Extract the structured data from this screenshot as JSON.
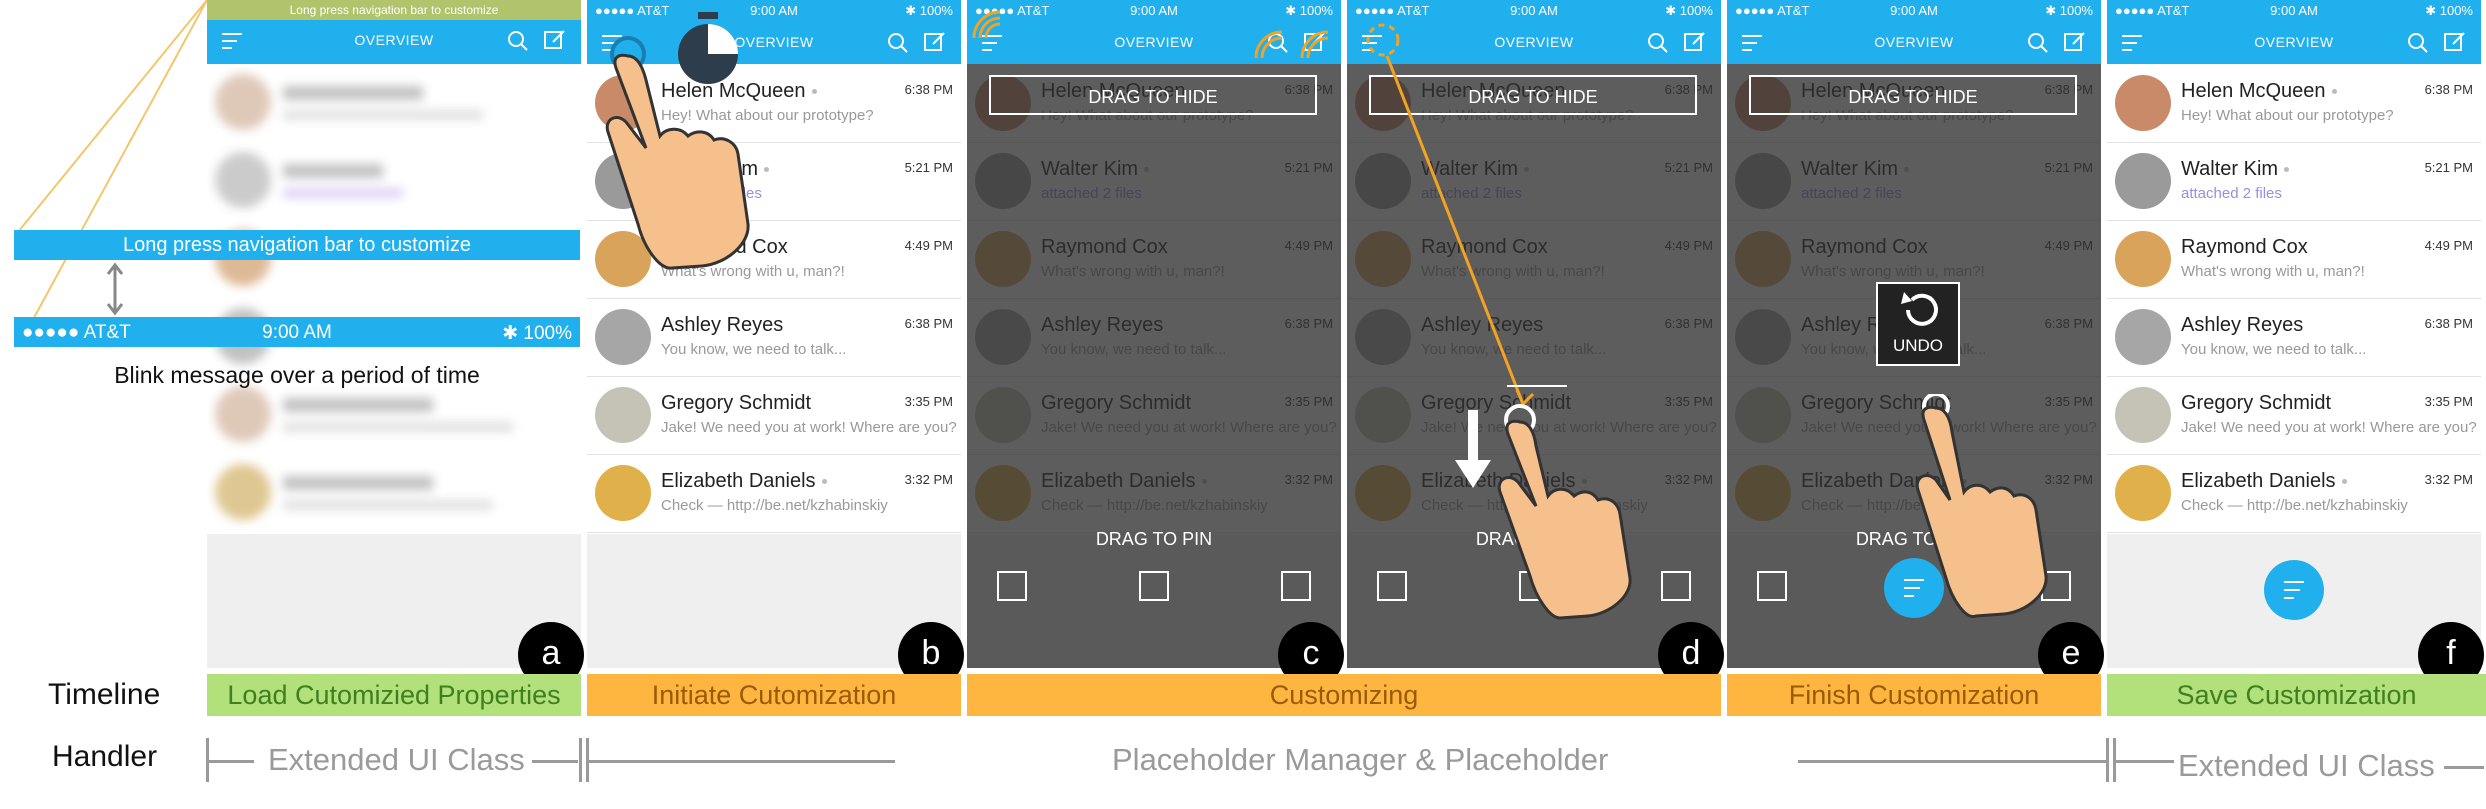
{
  "status": {
    "carrier": "●●●●● AT&T",
    "time": "9:00 AM",
    "battery": "✱ 100%"
  },
  "nav_title": "OVERVIEW",
  "contacts": [
    {
      "name": "Helen McQueen",
      "time": "6:38 PM",
      "message": "Hey! What about our prototype?"
    },
    {
      "name": "Walter Kim",
      "time": "5:21 PM",
      "message": "attached 2 files"
    },
    {
      "name": "Raymond Cox",
      "time": "4:49 PM",
      "message": "What's wrong with u, man?!"
    },
    {
      "name": "Ashley Reyes",
      "time": "6:38 PM",
      "message": "You know, we need to talk..."
    },
    {
      "name": "Gregory Schmidt",
      "time": "3:35 PM",
      "message": "Jake! We need you at work! Where are you?"
    },
    {
      "name": "Elizabeth Daniels",
      "time": "3:32 PM",
      "message": "Check — http://be.net/kzhabinskiy"
    }
  ],
  "panel_a": {
    "top_banner": "Long press navigation bar to customize",
    "callout": "Long press navigation bar to customize",
    "zoom_carrier": "●●●●● AT&T",
    "zoom_time": "9:00 AM",
    "zoom_battery": "✱ 100%",
    "blink_caption": "Blink message over a period of time"
  },
  "overlay": {
    "hide_label": "DRAG TO HIDE",
    "pin_label": "DRAG TO PIN",
    "undo_label": "UNDO"
  },
  "panel_letters": [
    "a",
    "b",
    "c",
    "d",
    "e",
    "f"
  ],
  "row_labels": {
    "timeline": "Timeline",
    "handler": "Handler"
  },
  "stages": [
    "Load Cutomizied Properties",
    "Initiate Cutomization",
    "Customizing",
    "Finish Customization",
    "Save Customization"
  ],
  "handlers": [
    "Extended UI Class",
    "Placeholder Manager & Placeholder",
    "Extended UI Class"
  ],
  "colors": {
    "accent": "#20b0ee",
    "timeline_green": "#b2e07a",
    "timeline_orange": "#ffb640",
    "highlight": "#f3a321"
  }
}
